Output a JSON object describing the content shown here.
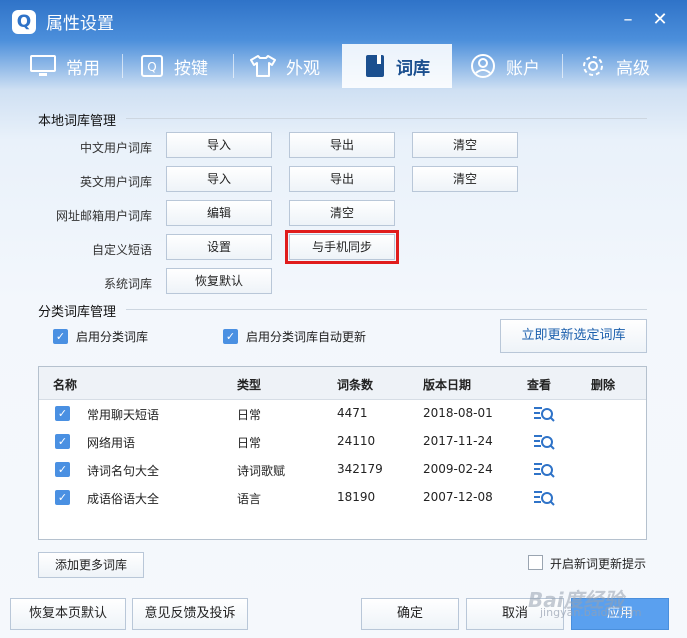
{
  "window": {
    "title": "属性设置",
    "app_letter": "Q",
    "minimize": "–",
    "close": "✕"
  },
  "tabs": [
    {
      "label": "常用",
      "icon": "monitor-icon"
    },
    {
      "label": "按键",
      "icon": "q-key-icon"
    },
    {
      "label": "外观",
      "icon": "shirt-icon"
    },
    {
      "label": "词库",
      "icon": "book-icon",
      "active": true
    },
    {
      "label": "账户",
      "icon": "user-icon"
    },
    {
      "label": "高级",
      "icon": "gear-icon"
    }
  ],
  "local": {
    "heading": "本地词库管理",
    "rows": [
      {
        "label": "中文用户词库",
        "buttons": [
          "导入",
          "导出",
          "清空"
        ]
      },
      {
        "label": "英文用户词库",
        "buttons": [
          "导入",
          "导出",
          "清空"
        ]
      },
      {
        "label": "网址邮箱用户词库",
        "buttons": [
          "编辑",
          "清空"
        ]
      },
      {
        "label": "自定义短语",
        "buttons": [
          "设置",
          "与手机同步"
        ]
      },
      {
        "label": "系统词库",
        "buttons": [
          "恢复默认"
        ]
      }
    ]
  },
  "category": {
    "heading": "分类词库管理",
    "enable_label": "启用分类词库",
    "auto_update_label": "启用分类词库自动更新",
    "update_button": "立即更新选定词库",
    "columns": [
      "名称",
      "类型",
      "词条数",
      "版本日期",
      "查看",
      "删除"
    ],
    "rows": [
      {
        "name": "常用聊天短语",
        "type": "日常",
        "count": "4471",
        "date": "2018-08-01"
      },
      {
        "name": "网络用语",
        "type": "日常",
        "count": "24110",
        "date": "2017-11-24"
      },
      {
        "name": "诗词名句大全",
        "type": "诗词歌赋",
        "count": "342179",
        "date": "2009-02-24"
      },
      {
        "name": "成语俗语大全",
        "type": "语言",
        "count": "18190",
        "date": "2007-12-08"
      }
    ],
    "add_more": "添加更多词库",
    "new_update_hint": "开启新词更新提示"
  },
  "footer": {
    "restore": "恢复本页默认",
    "feedback": "意见反馈及投诉",
    "ok": "确定",
    "cancel": "取消",
    "apply": "应用"
  },
  "watermark": {
    "brand": "Bai度经验",
    "url": "jingyan.baidu.com"
  },
  "colors": {
    "accent": "#2f73c8",
    "highlight": "#e01c1c",
    "checkbox": "#4a90e2"
  }
}
